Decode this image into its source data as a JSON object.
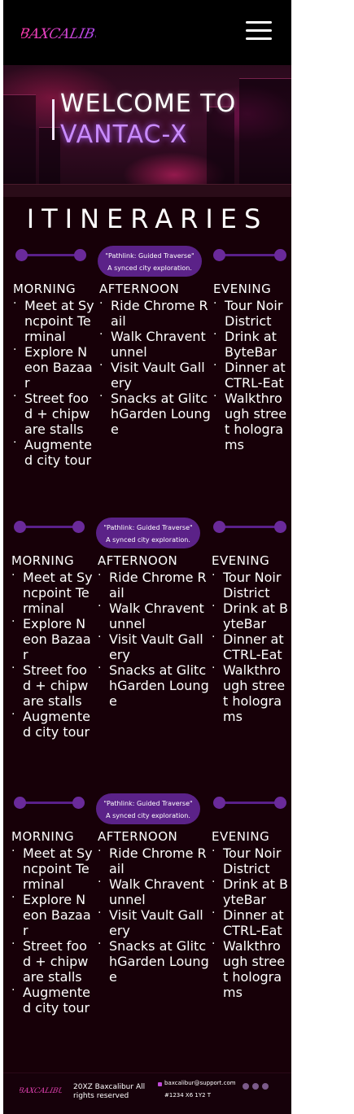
{
  "header": {
    "logo_text": "BAXCALIBUR",
    "menu_icon": "hamburger-menu-icon"
  },
  "hero": {
    "line1": "WELCOME TO",
    "line2": "VANTAC-X"
  },
  "section_title": "ITINERARIES",
  "itineraries": [
    {
      "pill_line1": "\"Pathlink: Guided Traverse\"",
      "pill_line2": "A synced city exploration.",
      "morning": {
        "label": "MORNING",
        "items": [
          "Meet at Syncpoint Terminal",
          "Explore Neon Bazaar",
          "Street food + chipware stalls",
          "Augmented city tour"
        ]
      },
      "afternoon": {
        "label": "AFTERNOON",
        "items": [
          "Ride Chrome Rail",
          "Walk Chraventunnel",
          "Visit Vault Gallery",
          "Snacks at GlitchGarden Lounge"
        ]
      },
      "evening": {
        "label": "EVENING",
        "items": [
          "Tour Noir District",
          "Drink at ByteBar",
          "Dinner at CTRL-Eat",
          "Walkthrough street holograms"
        ]
      }
    },
    {
      "pill_line1": "\"Pathlink: Guided Traverse\"",
      "pill_line2": "A synced city exploration.",
      "morning": {
        "label": "MORNING",
        "items": [
          "Meet at Syncpoint Terminal",
          "Explore Neon Bazaar",
          "Street food + chipware stalls",
          "Augmented city tour"
        ]
      },
      "afternoon": {
        "label": "AFTERNOON",
        "items": [
          "Ride Chrome Rail",
          "Walk Chraventunnel",
          "Visit Vault Gallery",
          "Snacks at GlitchGarden Lounge"
        ]
      },
      "evening": {
        "label": "EVENING",
        "items": [
          "Tour Noir District",
          "Drink at ByteBar",
          "Dinner at CTRL-Eat",
          "Walkthrough street holograms"
        ]
      }
    },
    {
      "pill_line1": "\"Pathlink: Guided Traverse\"",
      "pill_line2": "A synced city exploration.",
      "morning": {
        "label": "MORNING",
        "items": [
          "Meet at Syncpoint Terminal",
          "Explore Neon Bazaar",
          "Street food + chipware stalls",
          "Augmented city tour"
        ]
      },
      "afternoon": {
        "label": "AFTERNOON",
        "items": [
          "Ride Chrome Rail",
          "Walk Chraventunnel",
          "Visit Vault Gallery",
          "Snacks at GlitchGarden Lounge"
        ]
      },
      "evening": {
        "label": "EVENING",
        "items": [
          "Tour Noir District",
          "Drink at ByteBar",
          "Dinner at CTRL-Eat",
          "Walkthrough street holograms"
        ]
      }
    }
  ],
  "footer": {
    "logo_text": "BAXCALIBUR",
    "copyright": "20XZ Baxcalibur All rights reserved",
    "email": "baxcalibur@support.com",
    "phone": "#1234 X6 1Y2 T",
    "social_icons": [
      "facebook-icon",
      "x-icon",
      "instagram-icon"
    ]
  },
  "colors": {
    "accent": "#5b2288",
    "background": "#170008",
    "hero_highlight": "#c98cff"
  }
}
